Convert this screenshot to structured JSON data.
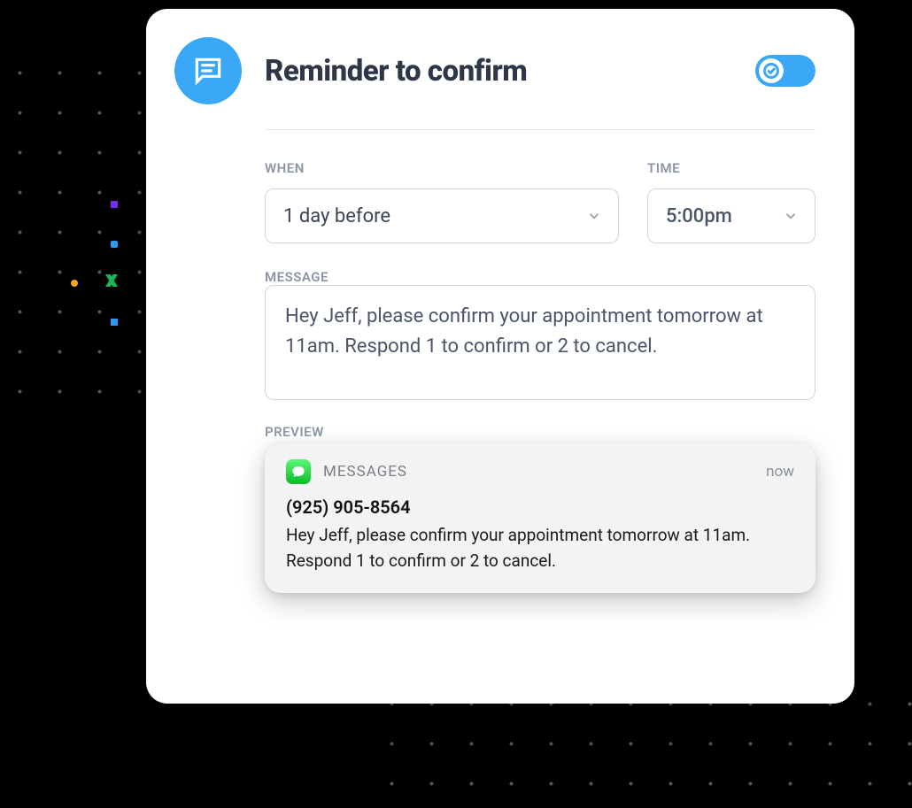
{
  "header": {
    "title": "Reminder to confirm",
    "icon": "chat-bubble-icon",
    "toggle_on": true
  },
  "labels": {
    "when": "WHEN",
    "time": "TIME",
    "message": "MESSAGE",
    "preview": "PREVIEW"
  },
  "fields": {
    "when_value": "1 day before",
    "time_value": "5:00pm",
    "message_value": "Hey Jeff, please confirm your appointment tomorrow at 11am. Respond 1 to confirm or 2 to cancel."
  },
  "preview": {
    "app_name": "MESSAGES",
    "timestamp": "now",
    "sender": "(925) 905-8564",
    "body": "Hey Jeff, please confirm your appointment tomorrow at 11am. Respond 1 to confirm or 2 to cancel."
  },
  "colors": {
    "accent": "#3aa8f7",
    "text_dark": "#2d3748",
    "text_muted": "#8b96a5",
    "border": "#d1d5db"
  }
}
